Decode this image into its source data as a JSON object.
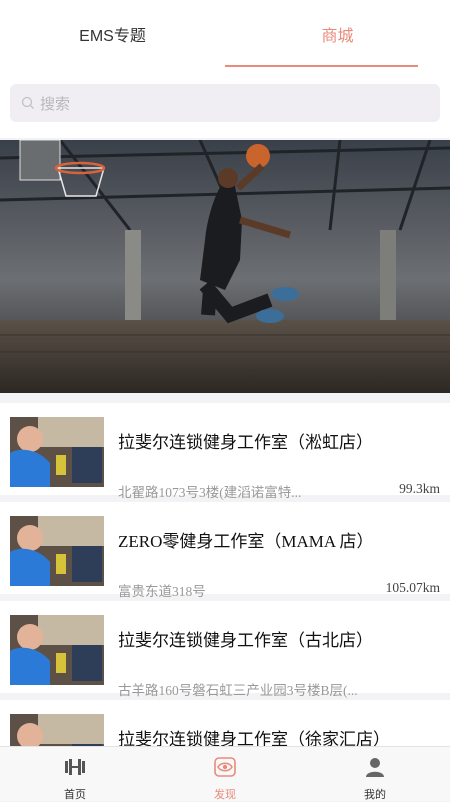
{
  "tabs": [
    {
      "label": "EMS专题",
      "active": false
    },
    {
      "label": "商城",
      "active": true
    }
  ],
  "search": {
    "placeholder": "搜索"
  },
  "colors": {
    "accent": "#e98a7a",
    "background": "#f3f3f5"
  },
  "stores": [
    {
      "name": "拉斐尔连锁健身工作室（淞虹店）",
      "address": "北翟路1073号3楼(建滔诺富特...",
      "distance": "99.3km"
    },
    {
      "name": "ZERO零健身工作室（MAMA 店）",
      "address": "富贵东道318号",
      "distance": "105.07km"
    },
    {
      "name": "拉斐尔连锁健身工作室（古北店）",
      "address": "古羊路160号磐石虹三产业园3号楼B层(...",
      "distance": ""
    },
    {
      "name": "拉斐尔连锁健身工作室（徐家汇店）",
      "address": "",
      "distance": ""
    }
  ],
  "bottom_nav": [
    {
      "label": "首页",
      "icon": "dumbbell-icon",
      "active": false
    },
    {
      "label": "发现",
      "icon": "eye-icon",
      "active": true
    },
    {
      "label": "我的",
      "icon": "user-icon",
      "active": false
    }
  ]
}
